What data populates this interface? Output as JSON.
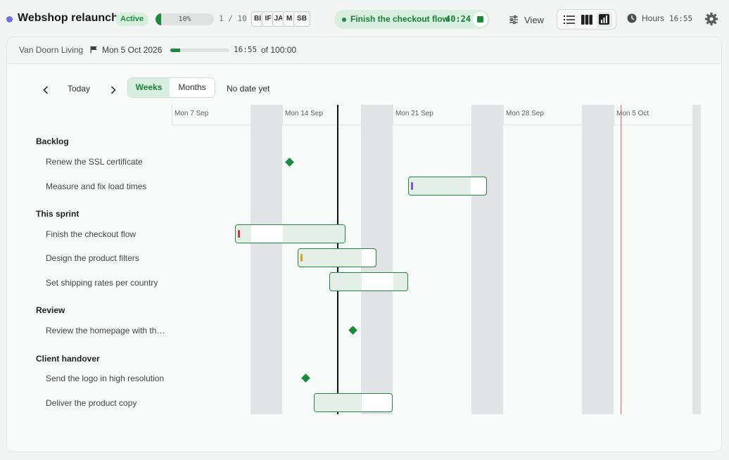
{
  "project": {
    "title": "Webshop relaunch",
    "status": "Active",
    "progress_percent": 10,
    "progress_label": "10%",
    "task_count": "1 / 10",
    "avatars": [
      "BI",
      "IF",
      "JA",
      "M",
      "SB"
    ]
  },
  "timer": {
    "task": "Finish the checkout flow",
    "elapsed": "40:24"
  },
  "toolbar": {
    "view_label": "View",
    "hours_label": "Hours",
    "hours_value": "16:55",
    "view_modes": [
      "list-icon",
      "board-icon",
      "chart-icon"
    ],
    "active_view_mode": "chart-icon"
  },
  "header": {
    "client": "Van Doorn Living",
    "deadline": "Mon 5 Oct 2026",
    "hours_used": "16:55",
    "hours_total": "of 100:00",
    "hours_fraction": 0.17
  },
  "nav": {
    "today": "Today",
    "weeks": "Weeks",
    "months": "Months",
    "no_date": "No date yet"
  },
  "timeline": {
    "week_labels": [
      "Mon 7 Sep",
      "Mon 14 Sep",
      "Mon 21 Sep",
      "Mon 28 Sep",
      "Mon 5 Oct"
    ]
  },
  "groups": [
    {
      "name": "Backlog",
      "tasks": [
        {
          "name": "Renew the SSL certificate",
          "type": "milestone"
        },
        {
          "name": "Measure and fix load times",
          "type": "bar",
          "mark_color": "#8b4fd8"
        }
      ]
    },
    {
      "name": "This sprint",
      "tasks": [
        {
          "name": "Finish the checkout flow",
          "type": "bar",
          "mark_color": "#d8323f"
        },
        {
          "name": "Design the product filters",
          "type": "bar",
          "mark_color": "#e89a1a"
        },
        {
          "name": "Set shipping rates per country",
          "type": "bar"
        }
      ]
    },
    {
      "name": "Review",
      "tasks": [
        {
          "name": "Review the homepage with the client",
          "type": "milestone"
        }
      ]
    },
    {
      "name": "Client handover",
      "tasks": [
        {
          "name": "Send the logo in high resolution",
          "type": "milestone"
        },
        {
          "name": "Deliver the product copy",
          "type": "bar"
        }
      ]
    }
  ]
}
